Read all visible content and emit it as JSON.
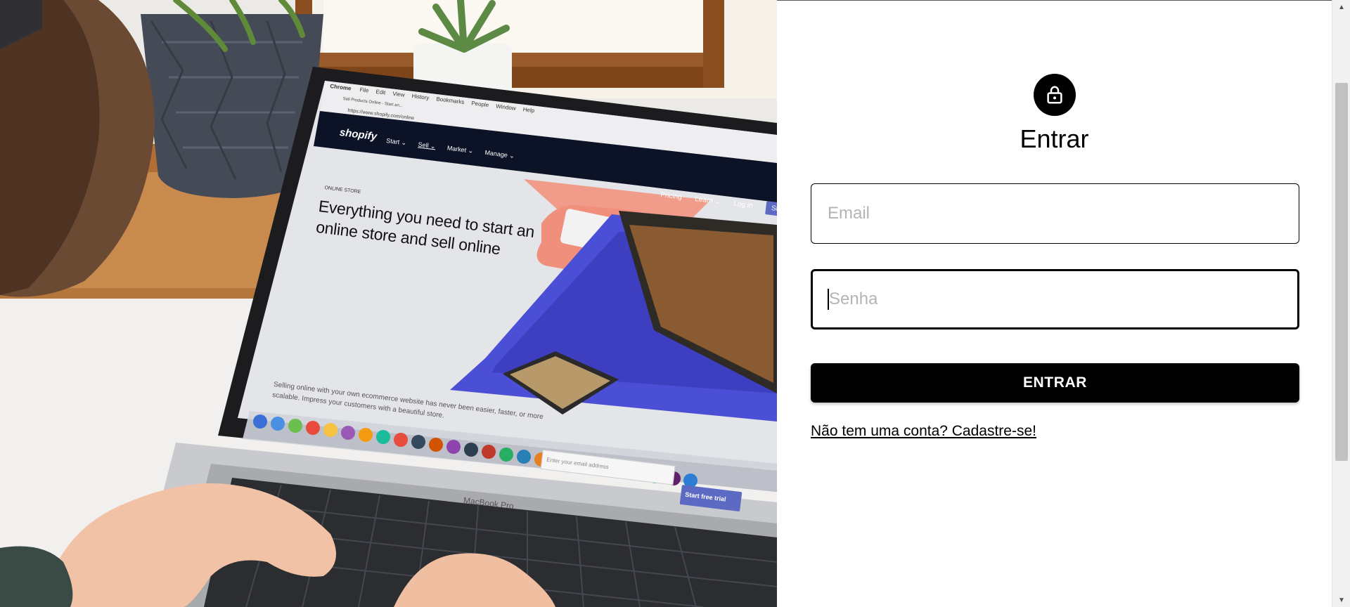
{
  "hero": {
    "image_alt": "Pessoa usando um MacBook Pro com a página da Shopify aberta",
    "browser_menu": [
      "Chrome",
      "File",
      "Edit",
      "View",
      "History",
      "Bookmarks",
      "People",
      "Window",
      "Help"
    ],
    "tab_title": "Sell Products Online - Start an...",
    "url": "https://www.shopify.com/online",
    "site_logo": "shopify",
    "site_nav": [
      "Start ⌄",
      "Sell ⌄",
      "Market ⌄",
      "Manage ⌄"
    ],
    "site_nav_right": [
      "Pricing",
      "Learn ⌄",
      "Log in",
      "Start"
    ],
    "eyebrow": "ONLINE STORE",
    "headline_line1": "Everything you need to start an",
    "headline_line2": "online store and sell online",
    "body_line1": "Selling online with your own ecommerce website has never been easier, faster, or more",
    "body_line2": "scalable. Impress your customers with a beautiful store.",
    "email_placeholder": "Enter your email address",
    "cta": "Start free trial",
    "laptop_label": "MacBook Pro",
    "colors": {
      "shopify_nav": "#0d1326",
      "cta_blue": "#5c6ac4",
      "accent_coral": "#f19c8a",
      "accent_blue": "#4b4fd6"
    }
  },
  "login": {
    "icon": "lock-icon",
    "title": "Entrar",
    "email_placeholder": "Email",
    "password_placeholder": "Senha",
    "submit_label": "ENTRAR",
    "signup_link": "Não tem uma conta? Cadastre-se!"
  },
  "scrollbar": {
    "up_icon": "scroll-up-arrow-icon",
    "down_icon": "scroll-down-arrow-icon"
  }
}
